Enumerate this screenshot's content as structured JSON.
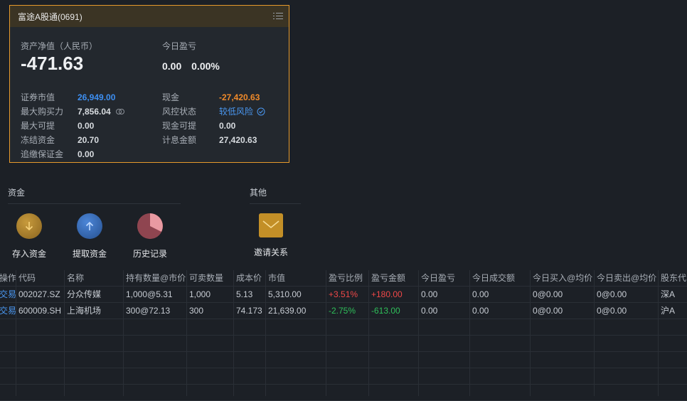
{
  "account": {
    "title": "富途A股通(0691)",
    "net_assets_label": "资产净值（人民币）",
    "net_assets_value": "-471.63",
    "today_pnl_label": "今日盈亏",
    "today_pnl_value": "0.00",
    "today_pnl_pct": "0.00%",
    "left_items": [
      {
        "label": "证券市值",
        "value": "26,949.00"
      },
      {
        "label": "最大购买力",
        "value": "7,856.04"
      },
      {
        "label": "最大可提",
        "value": "0.00"
      },
      {
        "label": "冻结资金",
        "value": "20.70"
      },
      {
        "label": "追缴保证金",
        "value": "0.00"
      }
    ],
    "right_items": [
      {
        "label": "现金",
        "value": "-27,420.63"
      },
      {
        "label": "风控状态",
        "value": "较低风险"
      },
      {
        "label": "现金可提",
        "value": "0.00"
      },
      {
        "label": "计息金额",
        "value": "27,420.63"
      }
    ]
  },
  "funds_section": {
    "title": "资金",
    "actions": [
      {
        "label": "存入资金",
        "icon": "deposit-arrow-down-icon"
      },
      {
        "label": "提取资金",
        "icon": "withdraw-arrow-up-icon"
      },
      {
        "label": "历史记录",
        "icon": "history-pie-icon"
      }
    ]
  },
  "other_section": {
    "title": "其他",
    "actions": [
      {
        "label": "邀请关系",
        "icon": "envelope-icon"
      }
    ]
  },
  "table": {
    "headers": [
      "操作",
      "代码",
      "名称",
      "持有数量@市价",
      "可卖数量",
      "成本价",
      "市值",
      "盈亏比例",
      "盈亏金额",
      "今日盈亏",
      "今日成交额",
      "今日买入@均价",
      "今日卖出@均价",
      "股东代"
    ],
    "rows": [
      [
        "交易",
        "002027.SZ",
        "分众传媒",
        "1,000@5.31",
        "1,000",
        "5.13",
        "5,310.00",
        "+3.51%",
        "+180.00",
        "0.00",
        "0.00",
        "0@0.00",
        "0@0.00",
        "深A"
      ],
      [
        "交易",
        "600009.SH",
        "上海机场",
        "300@72.13",
        "300",
        "74.173",
        "21,639.00",
        "-2.75%",
        "-613.00",
        "0.00",
        "0.00",
        "0@0.00",
        "0@0.00",
        "沪A"
      ]
    ]
  },
  "colors": {
    "accent_border": "#e69a2c",
    "positive": "#f04848",
    "negative": "#2fbf5a",
    "link": "#3d8ff2",
    "cash_negative": "#f08a2a"
  }
}
